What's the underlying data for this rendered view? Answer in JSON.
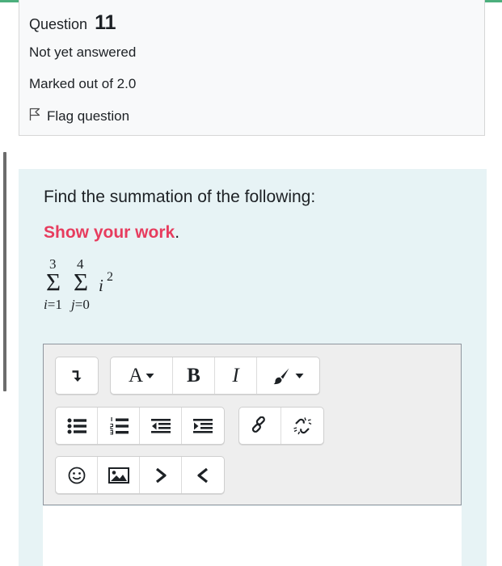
{
  "question": {
    "label": "Question",
    "number": "11",
    "status": "Not yet answered",
    "marks": "Marked out of 2.0",
    "flag_label": "Flag question"
  },
  "content": {
    "prompt": "Find the summation of the following:",
    "work_emphasis": "Show your work",
    "work_suffix": ".",
    "formula": {
      "outer_upper": "3",
      "inner_upper": "4",
      "sigma": "Σ",
      "term_base": "i",
      "term_exponent": "2",
      "outer_lower_var": "i",
      "outer_lower_rest": "=1",
      "inner_lower_var": "j",
      "inner_lower_rest": "=0"
    }
  },
  "toolbar": {
    "bold_label": "B",
    "italic_label": "I",
    "font_label": "A",
    "icons": [
      "toolbar-toggle-icon",
      "font-color-icon",
      "bold-icon",
      "italic-icon",
      "paint-brush-icon",
      "unordered-list-icon",
      "ordered-list-icon",
      "outdent-icon",
      "indent-icon",
      "link-icon",
      "unlink-icon",
      "emoji-icon",
      "image-icon",
      "chevron-right-icon",
      "chevron-left-icon"
    ]
  },
  "colors": {
    "accent": "#4caf7d",
    "emphasis": "#e73c5e",
    "content_bg": "#e7f3f5",
    "info_bg": "#f8f9fa",
    "editor_bg": "#eeeeee"
  }
}
